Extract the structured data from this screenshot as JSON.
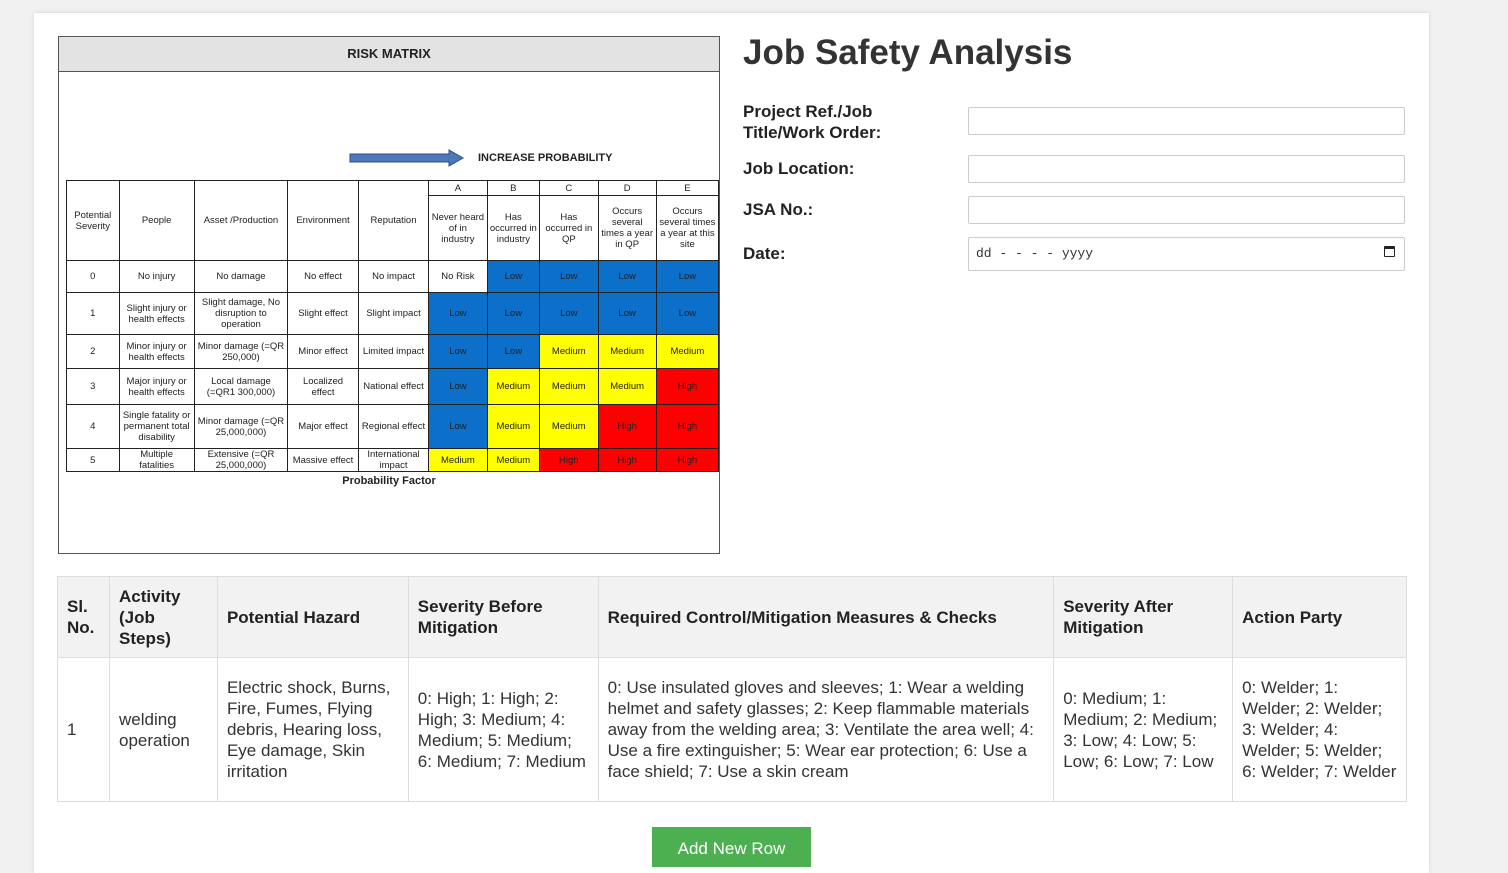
{
  "risk_matrix": {
    "title": "RISK MATRIX",
    "increase_probability": "INCREASE PROBABILITY",
    "probability_factor": "Probability Factor",
    "headers": {
      "severity": "Potential Severity",
      "people": "People",
      "asset": "Asset /Production",
      "environment": "Environment",
      "reputation": "Reputation"
    },
    "columns": [
      {
        "letter": "A",
        "desc": "Never heard of in industry"
      },
      {
        "letter": "B",
        "desc": "Has occurred in industry"
      },
      {
        "letter": "C",
        "desc": "Has occurred in QP"
      },
      {
        "letter": "D",
        "desc": "Occurs several times a year in QP"
      },
      {
        "letter": "E",
        "desc": "Occurs several times a year at this site"
      }
    ],
    "rows": [
      {
        "severity": "0",
        "people": "No injury",
        "asset": "No damage",
        "environment": "No effect",
        "reputation": "No impact",
        "cells": [
          "No Risk",
          "Low",
          "Low",
          "Low",
          "Low"
        ],
        "colors": [
          "none",
          "blue",
          "blue",
          "blue",
          "blue"
        ]
      },
      {
        "severity": "1",
        "people": "Slight injury or health effects",
        "asset": "Slight damage, No disruption to operation",
        "environment": "Slight effect",
        "reputation": "Slight impact",
        "cells": [
          "Low",
          "Low",
          "Low",
          "Low",
          "Low"
        ],
        "colors": [
          "blue",
          "blue",
          "blue",
          "blue",
          "blue"
        ]
      },
      {
        "severity": "2",
        "people": "Minor injury or health effects",
        "asset": "Minor damage (=QR 250,000)",
        "environment": "Minor effect",
        "reputation": "Limited impact",
        "cells": [
          "Low",
          "Low",
          "Medium",
          "Medium",
          "Medium"
        ],
        "colors": [
          "blue",
          "blue",
          "yellow",
          "yellow",
          "yellow"
        ]
      },
      {
        "severity": "3",
        "people": "Major injury or health effects",
        "asset": "Local damage (=QR1 300,000)",
        "environment": "Localized effect",
        "reputation": "National effect",
        "cells": [
          "Low",
          "Medium",
          "Medium",
          "Medium",
          "High"
        ],
        "colors": [
          "blue",
          "yellow",
          "yellow",
          "yellow",
          "red"
        ]
      },
      {
        "severity": "4",
        "people": "Single fatality or permanent total disability",
        "asset": "Minor damage (=QR 25,000,000)",
        "environment": "Major effect",
        "reputation": "Regional effect",
        "cells": [
          "Low",
          "Medium",
          "Medium",
          "High",
          "High"
        ],
        "colors": [
          "blue",
          "yellow",
          "yellow",
          "red",
          "red"
        ]
      },
      {
        "severity": "5",
        "people": "Multiple fatalities",
        "asset": "Extensive (=QR 25,000,000)",
        "environment": "Massive effect",
        "reputation": "International impact",
        "cells": [
          "Medium",
          "Medium",
          "High",
          "High",
          "High"
        ],
        "colors": [
          "yellow",
          "yellow",
          "red",
          "red",
          "red"
        ]
      }
    ],
    "colors": {
      "blue": "#0c6fc9",
      "yellow": "#ffff00",
      "red": "#ff0000",
      "none": "#ffffff"
    }
  },
  "form": {
    "title": "Job Safety Analysis",
    "project_label": "Project Ref./Job Title/Work Order:",
    "project_value": "",
    "location_label": "Job Location:",
    "location_value": "",
    "jsa_no_label": "JSA No.:",
    "jsa_no_value": "",
    "date_label": "Date:",
    "date_placeholder": "dd - - - - yyyy",
    "calendar_icon": "calendar-icon"
  },
  "table": {
    "headers": {
      "sl": "Sl. No.",
      "activity": "Activity (Job Steps)",
      "hazard": "Potential Hazard",
      "sev_before": "Severity Before Mitigation",
      "controls": "Required Control/Mitigation Measures & Checks",
      "sev_after": "Severity After Mitigation",
      "party": "Action Party"
    },
    "rows": [
      {
        "sl": "1",
        "activity": "welding operation",
        "hazard": "Electric shock, Burns, Fire, Fumes, Flying debris, Hearing loss, Eye damage, Skin irritation",
        "sev_before": "0: High; 1: High; 2: High; 3: Medium; 4: Medium; 5: Medium; 6: Medium; 7: Medium",
        "controls": "0: Use insulated gloves and sleeves; 1: Wear a welding helmet and safety glasses; 2: Keep flammable materials away from the welding area; 3: Ventilate the area well; 4: Use a fire extinguisher; 5: Wear ear protection; 6: Use a face shield; 7: Use a skin cream",
        "sev_after": "0: Medium; 1: Medium; 2: Medium; 3: Low; 4: Low; 5: Low; 6: Low; 7: Low",
        "party": "0: Welder; 1: Welder; 2: Welder; 3: Welder; 4: Welder; 5: Welder; 6: Welder; 7: Welder"
      }
    ]
  },
  "add_row_label": "Add New Row"
}
